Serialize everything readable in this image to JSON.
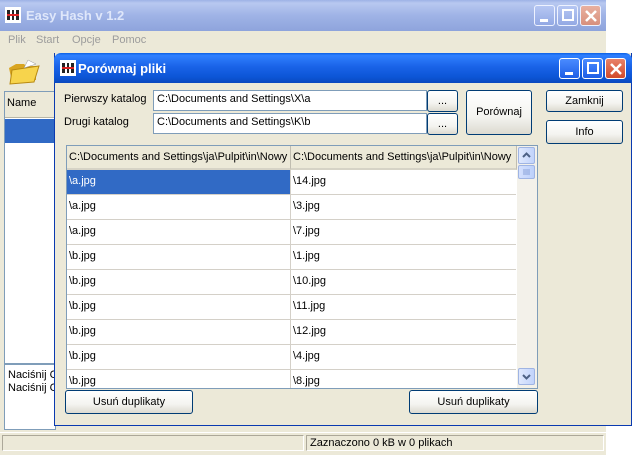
{
  "main": {
    "title": "Easy Hash v 1.2",
    "menu": [
      "Plik",
      "Start",
      "Opcje",
      "Pomoc"
    ],
    "left_header": "Name",
    "log_lines": [
      "Naciśnij C",
      "Naciśnij C"
    ],
    "status": "Zaznaczono 0 kB w 0 plikach"
  },
  "dialog": {
    "title": "Porównaj pliki",
    "first_label": "Pierwszy katalog",
    "second_label": "Drugi katalog",
    "first_value": "C:\\Documents and Settings\\X\\a",
    "second_value": "C:\\Documents and Settings\\K\\b",
    "browse_label": "...",
    "compare_label": "Porównaj",
    "close_label": "Zamknij",
    "info_label": "Info",
    "remove_left_label": "Usuń duplikaty",
    "remove_right_label": "Usuń duplikaty",
    "columns": [
      "C:\\Documents and Settings\\ja\\Pulpit\\in\\Nowy",
      "C:\\Documents and Settings\\ja\\Pulpit\\in\\Nowy"
    ],
    "rows": [
      {
        "left": "\\a.jpg",
        "right": "\\14.jpg"
      },
      {
        "left": "\\a.jpg",
        "right": "\\3.jpg"
      },
      {
        "left": "\\a.jpg",
        "right": "\\7.jpg"
      },
      {
        "left": "\\b.jpg",
        "right": "\\1.jpg"
      },
      {
        "left": "\\b.jpg",
        "right": "\\10.jpg"
      },
      {
        "left": "\\b.jpg",
        "right": "\\11.jpg"
      },
      {
        "left": "\\b.jpg",
        "right": "\\12.jpg"
      },
      {
        "left": "\\b.jpg",
        "right": "\\4.jpg"
      },
      {
        "left": "\\b.jpg",
        "right": "\\8.jpg"
      }
    ],
    "selected_row": 0
  },
  "colors": {
    "accent": "#0a5fe4",
    "selection": "#316ac5",
    "window_bg": "#ece9d8"
  }
}
